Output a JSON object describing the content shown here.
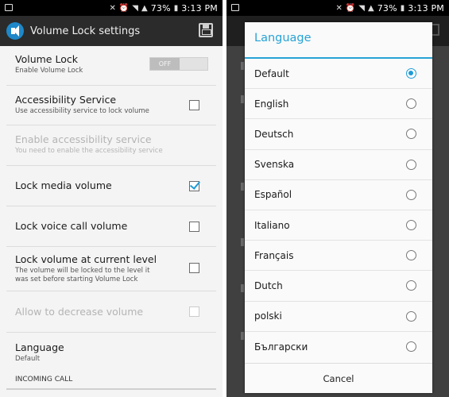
{
  "status_bar": {
    "battery": "73%",
    "time": "3:13 PM"
  },
  "app": {
    "title": "Volume Lock settings"
  },
  "settings": {
    "volume_lock": {
      "title": "Volume Lock",
      "summary": "Enable Volume Lock",
      "toggle_label": "OFF"
    },
    "accessibility": {
      "title": "Accessibility Service",
      "summary": "Use accessibility service to lock volume",
      "checked": false
    },
    "enable_accessibility": {
      "title": "Enable accessibility service",
      "summary": "You need to enable the accessibility service",
      "disabled": true
    },
    "lock_media": {
      "title": "Lock media volume",
      "checked": true
    },
    "lock_voice": {
      "title": "Lock voice call volume",
      "checked": false
    },
    "lock_current": {
      "title": "Lock volume at current level",
      "summary_line1": "The volume will be locked to the level it",
      "summary_line2": "was set before starting Volume Lock",
      "checked": false
    },
    "allow_decrease": {
      "title": "Allow to decrease volume",
      "disabled": true,
      "checked": false
    },
    "language": {
      "title": "Language",
      "summary": "Default"
    },
    "incoming_call": {
      "title": "INCOMING CALL"
    }
  },
  "language_dialog": {
    "title": "Language",
    "selected_index": 0,
    "options": [
      "Default",
      "English",
      "Deutsch",
      "Svenska",
      "Español",
      "Italiano",
      "Français",
      "Dutch",
      "polski",
      "Български"
    ],
    "cancel_label": "Cancel"
  },
  "colors": {
    "accent": "#27a3d6",
    "checkbox_check": "#1e9bd7",
    "action_bar": "#2b2b2b"
  }
}
